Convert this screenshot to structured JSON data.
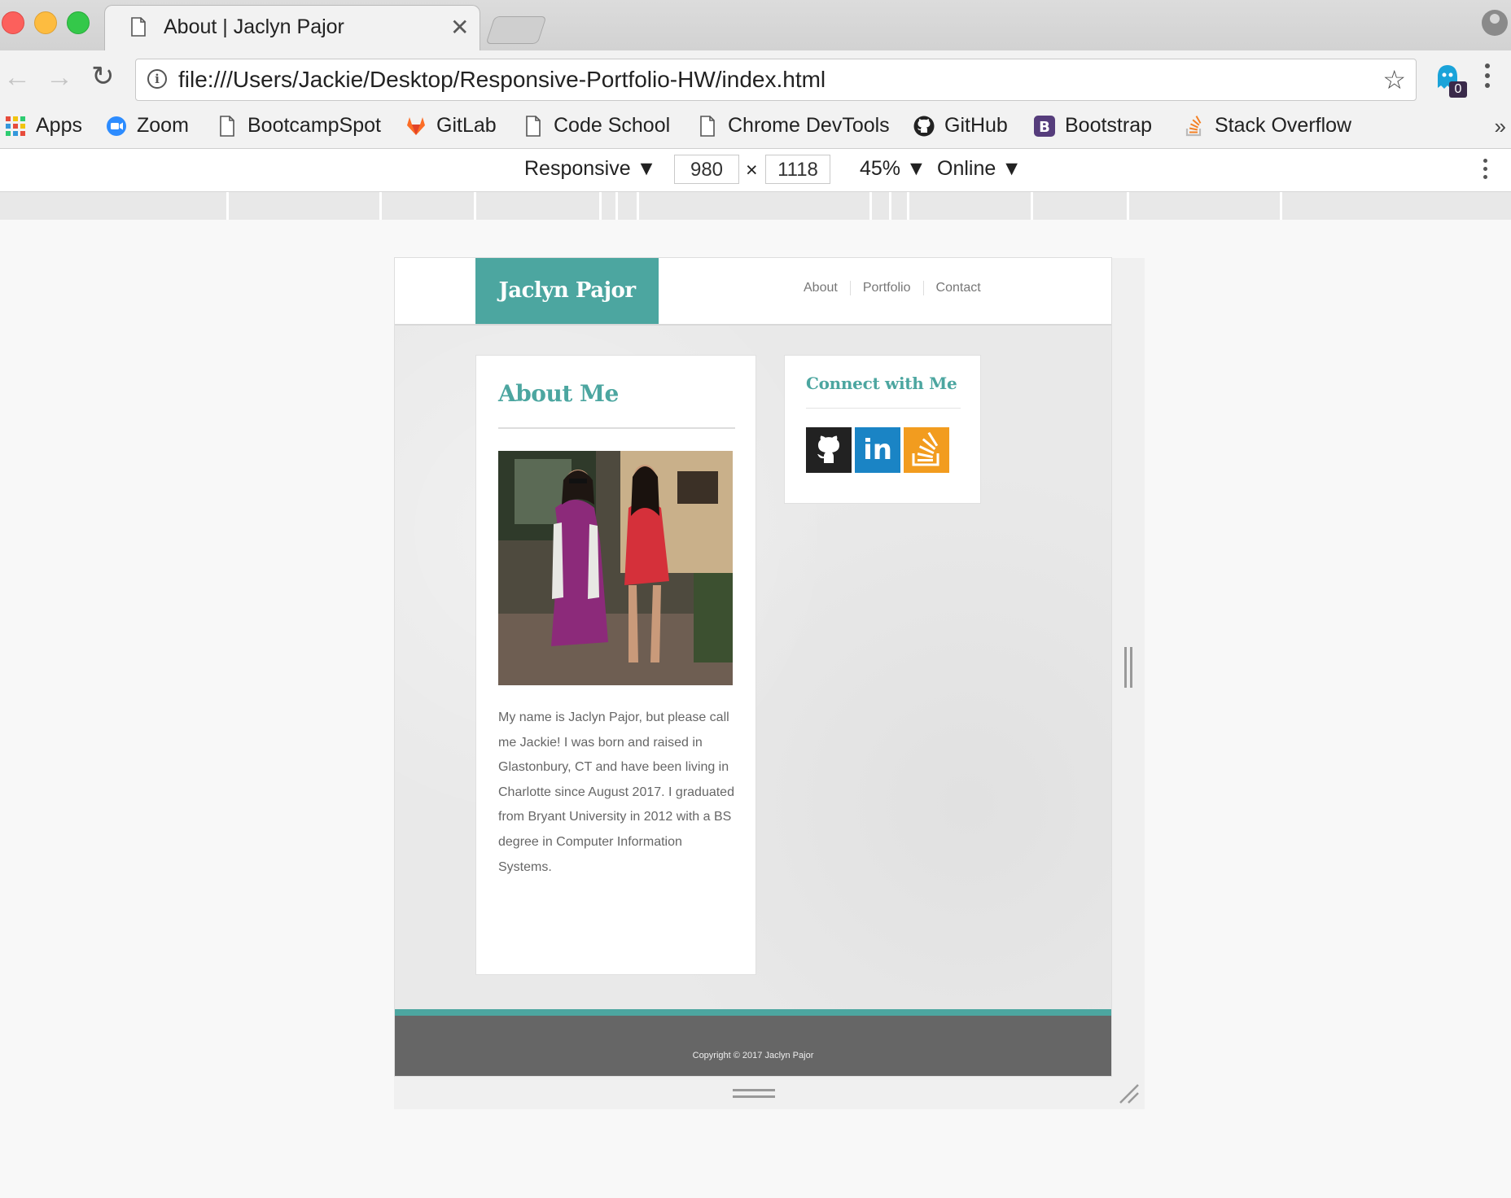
{
  "browser": {
    "tab_title": "About | Jaclyn Pajor",
    "close_glyph": "✕",
    "back_glyph": "←",
    "forward_glyph": "→",
    "reload_glyph": "↻",
    "url": "file:///Users/Jackie/Desktop/Responsive-Portfolio-HW/index.html",
    "star_glyph": "☆",
    "extension_badge": "0",
    "bookmarks": [
      {
        "label": "Apps",
        "icon": "apps-grid-icon"
      },
      {
        "label": "Zoom",
        "icon": "zoom-icon"
      },
      {
        "label": "BootcampSpot",
        "icon": "page-icon"
      },
      {
        "label": "GitLab",
        "icon": "gitlab-icon"
      },
      {
        "label": "Code School",
        "icon": "page-icon"
      },
      {
        "label": "Chrome DevTools",
        "icon": "page-icon"
      },
      {
        "label": "GitHub",
        "icon": "github-icon"
      },
      {
        "label": "Bootstrap",
        "icon": "bootstrap-icon"
      },
      {
        "label": "Stack Overflow",
        "icon": "stackoverflow-icon"
      }
    ],
    "bookmarks_more": "»"
  },
  "device_toolbar": {
    "mode": "Responsive ▼",
    "width": "980",
    "times": "×",
    "height": "1118",
    "zoom": "45% ▼",
    "network": "Online ▼"
  },
  "site": {
    "brand": "Jaclyn Pajor",
    "nav": [
      "About",
      "Portfolio",
      "Contact"
    ],
    "about_title": "About Me",
    "about_text": "My name is Jaclyn Pajor, but please call me Jackie! I was born and raised in Glastonbury, CT and have been living in Charlotte since August 2017. I graduated from Bryant University in 2012 with a BS degree in Computer Information Systems.",
    "connect_title": "Connect with Me",
    "social": [
      {
        "name": "github",
        "icon": "github-icon",
        "color": "#222222"
      },
      {
        "name": "linkedin",
        "icon": "linkedin-icon",
        "color": "#1a84c5",
        "text": "in"
      },
      {
        "name": "stackoverflow",
        "icon": "stackoverflow-icon",
        "color": "#f29c1f"
      }
    ],
    "copyright": "Copyright © 2017 Jaclyn Pajor",
    "accent_color": "#4ca6a0",
    "footer_color": "#666666"
  }
}
